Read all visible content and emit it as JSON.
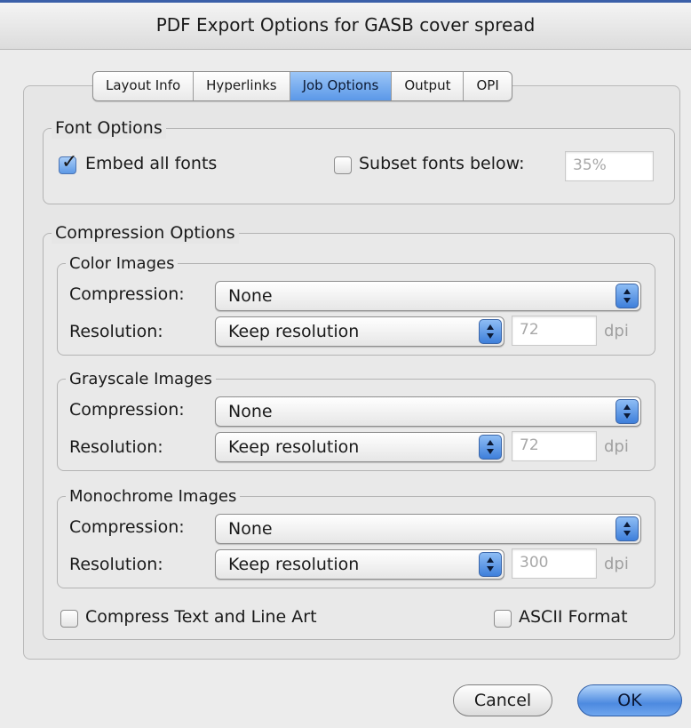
{
  "window": {
    "title": "PDF Export Options for GASB cover spread"
  },
  "tabs": [
    {
      "label": "Layout Info"
    },
    {
      "label": "Hyperlinks"
    },
    {
      "label": "Job Options",
      "active": true
    },
    {
      "label": "Output"
    },
    {
      "label": "OPI"
    }
  ],
  "font_options": {
    "title": "Font Options",
    "embed_all_fonts": {
      "label": "Embed all fonts",
      "checked": true
    },
    "subset_fonts_below": {
      "label": "Subset fonts below:",
      "checked": false,
      "value": "35%"
    }
  },
  "compression_options": {
    "title": "Compression Options",
    "color_images": {
      "title": "Color Images",
      "compression_label": "Compression:",
      "compression_value": "None",
      "resolution_label": "Resolution:",
      "resolution_value": "Keep resolution",
      "dpi_value": "72",
      "dpi_unit": "dpi"
    },
    "grayscale_images": {
      "title": "Grayscale Images",
      "compression_label": "Compression:",
      "compression_value": "None",
      "resolution_label": "Resolution:",
      "resolution_value": "Keep resolution",
      "dpi_value": "72",
      "dpi_unit": "dpi"
    },
    "monochrome_images": {
      "title": "Monochrome Images",
      "compression_label": "Compression:",
      "compression_value": "None",
      "resolution_label": "Resolution:",
      "resolution_value": "Keep resolution",
      "dpi_value": "300",
      "dpi_unit": "dpi"
    },
    "compress_text_line_art": {
      "label": "Compress Text and Line Art",
      "checked": false
    },
    "ascii_format": {
      "label": "ASCII Format",
      "checked": false
    }
  },
  "buttons": {
    "cancel": "Cancel",
    "ok": "OK"
  },
  "colors": {
    "accent": "#5b98e8",
    "title_bar_stripe": "#3a5fa8",
    "background": "#ececec"
  }
}
